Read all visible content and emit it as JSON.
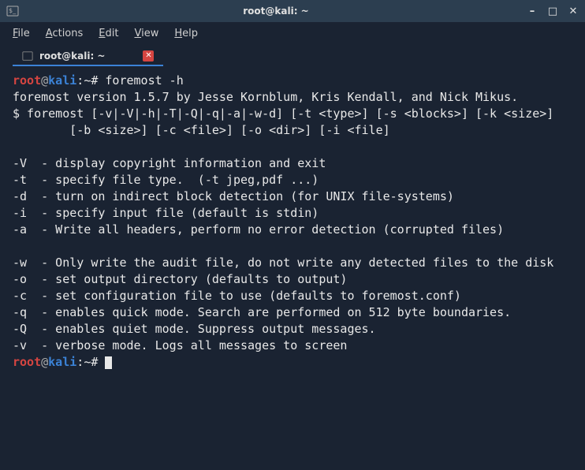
{
  "titlebar": {
    "title": "root@kali: ~"
  },
  "menubar": {
    "file": "File",
    "actions": "Actions",
    "edit": "Edit",
    "view": "View",
    "help": "Help"
  },
  "tab": {
    "label": "root@kali: ~"
  },
  "prompt": {
    "user": "root",
    "at": "@",
    "host": "kali",
    "colon": ":",
    "path": "~",
    "hash": "#"
  },
  "command1": "foremost -h",
  "output": {
    "l1": "foremost version 1.5.7 by Jesse Kornblum, Kris Kendall, and Nick Mikus.",
    "l2": "$ foremost [-v|-V|-h|-T|-Q|-q|-a|-w-d] [-t <type>] [-s <blocks>] [-k <size>]",
    "l3": "        [-b <size>] [-c <file>] [-o <dir>] [-i <file]",
    "l4": "",
    "l5": "-V  - display copyright information and exit",
    "l6": "-t  - specify file type.  (-t jpeg,pdf ...)",
    "l7": "-d  - turn on indirect block detection (for UNIX file-systems)",
    "l8": "-i  - specify input file (default is stdin)",
    "l9": "-a  - Write all headers, perform no error detection (corrupted files)",
    "l10": "",
    "l11": "-w  - Only write the audit file, do not write any detected files to the disk",
    "l12": "-o  - set output directory (defaults to output)",
    "l13": "-c  - set configuration file to use (defaults to foremost.conf)",
    "l14": "-q  - enables quick mode. Search are performed on 512 byte boundaries.",
    "l15": "-Q  - enables quiet mode. Suppress output messages.",
    "l16": "-v  - verbose mode. Logs all messages to screen"
  }
}
